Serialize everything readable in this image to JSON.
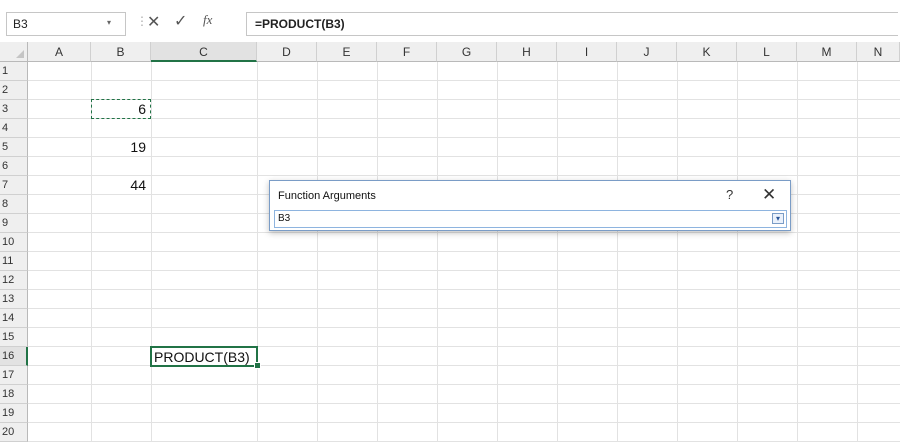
{
  "formula_bar": {
    "name_box": "B3",
    "name_box_dropdown": "▾",
    "separator": "⋮",
    "cancel_glyph": "✕",
    "enter_glyph": "✓",
    "fx_label": "fx",
    "formula": "=PRODUCT(B3)"
  },
  "columns": [
    "A",
    "B",
    "C",
    "D",
    "E",
    "F",
    "G",
    "H",
    "I",
    "J",
    "K",
    "L",
    "M",
    "N"
  ],
  "rows": [
    "1",
    "2",
    "3",
    "4",
    "5",
    "6",
    "7",
    "8",
    "9",
    "10",
    "11",
    "12",
    "13",
    "14",
    "15",
    "16",
    "17",
    "18",
    "19",
    "20"
  ],
  "selected_column": "C",
  "selected_row": "16",
  "cells": {
    "B3": "6",
    "B5": "19",
    "B7": "44",
    "C16": "PRODUCT(B3)"
  },
  "dialog": {
    "title": "Function Arguments",
    "help": "?",
    "close": "✕",
    "input_value": "B3",
    "expand_glyph": "▾"
  },
  "colors": {
    "accent": "#217346",
    "header_bg": "#efefef",
    "gridline": "#e2e2e2",
    "dialog_border": "#7a9cc6"
  }
}
